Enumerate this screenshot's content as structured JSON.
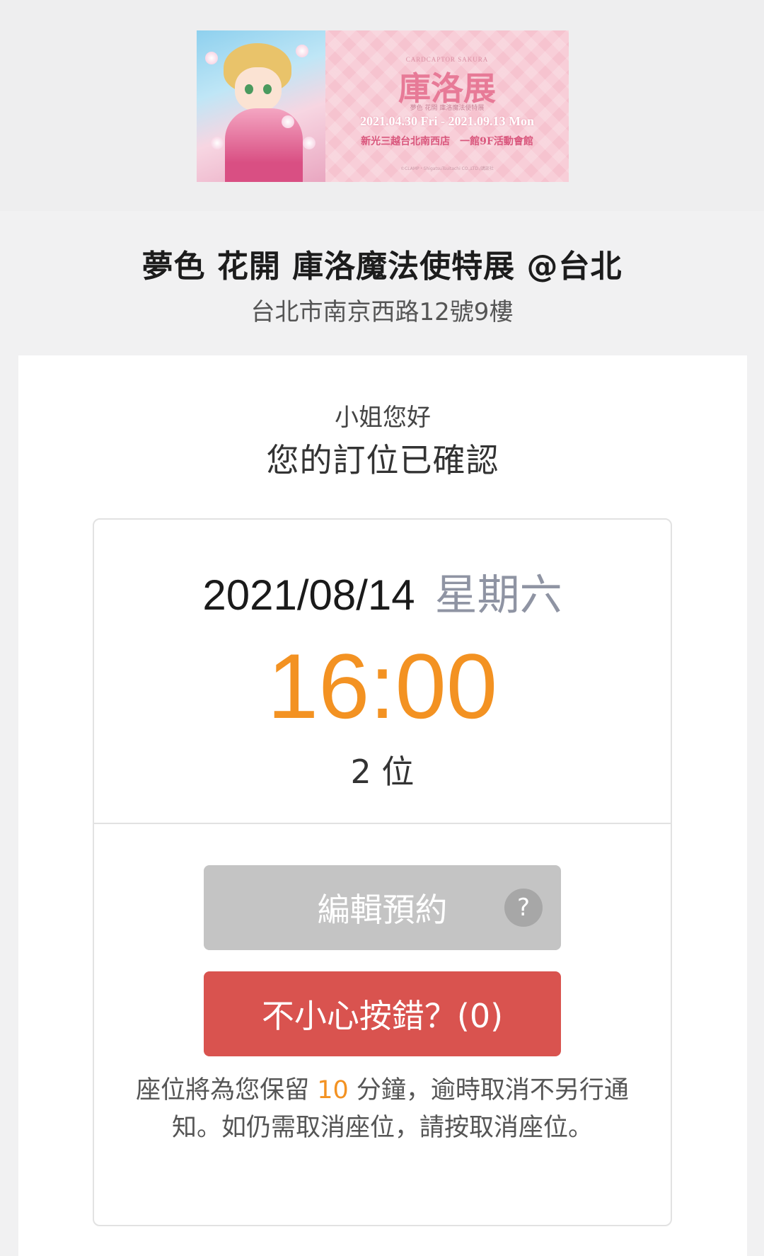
{
  "banner": {
    "subtitle": "CARDCAPTOR SAKURA",
    "title": "庫洛展",
    "tagline": "夢色 花開 庫洛魔法使特展",
    "dates": "2021.04.30 Fri - 2021.09.13 Mon",
    "venue": "新光三越台北南西店　一館9F活動會館",
    "copyright": "©CLAMP・ShigatsuTsuitachi CO.,LTD./講談社"
  },
  "event": {
    "title": "夢色 花開 庫洛魔法使特展 @台北",
    "address": "台北市南京西路12號9樓"
  },
  "confirmation": {
    "greeting": "小姐您好",
    "status": "您的訂位已確認"
  },
  "booking": {
    "date": "2021/08/14",
    "weekday": "星期六",
    "time": "16:00",
    "party_size": "2 位"
  },
  "actions": {
    "edit_label": "編輯預約",
    "help_symbol": "?",
    "cancel_label": "不小心按錯？(0)"
  },
  "note": {
    "part1": "座位將為您保留 ",
    "minutes": "10",
    "part2": " 分鐘，逾時取消不另行通知。如仍需取消座位，請按取消座位。"
  },
  "colors": {
    "accent": "#f39222",
    "cancel_button": "#d9534f",
    "edit_button": "#c4c4c4"
  }
}
